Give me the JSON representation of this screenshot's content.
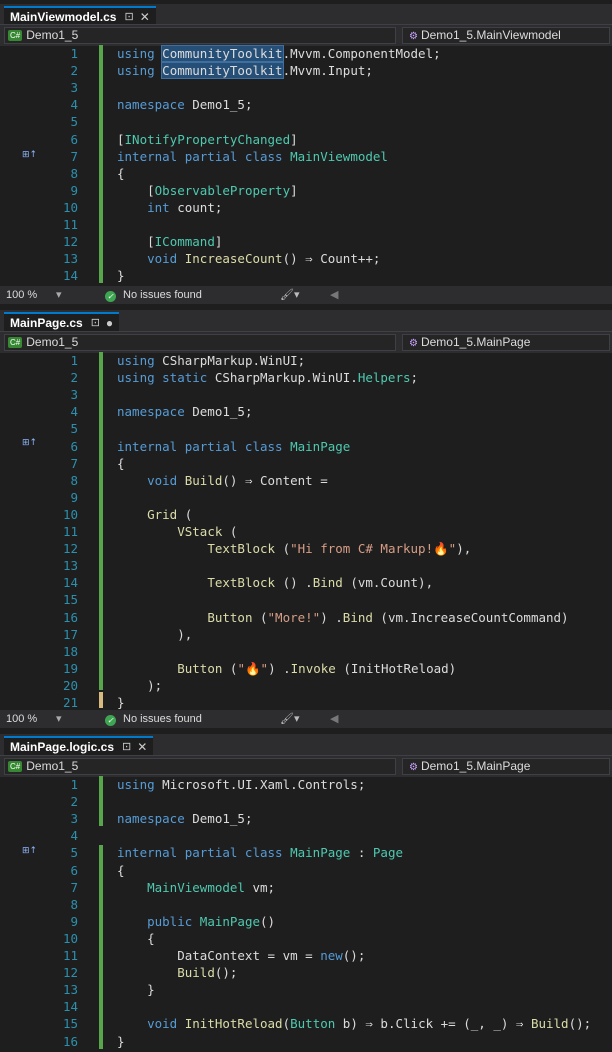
{
  "panes": [
    {
      "tab": "MainViewmodel.cs",
      "tab_state": "⊡",
      "nav_left": "Demo1_5",
      "nav_right": "Demo1_5.MainViewmodel",
      "status_zoom": "100 %",
      "status_issues": "No issues found",
      "lines": [
        {
          "n": "1",
          "html": "<span class=\"kw\">using</span> <span class=\"hl\">CommunityToolkit</span>.Mvvm.ComponentModel;"
        },
        {
          "n": "2",
          "html": "<span class=\"kw\">using</span> <span class=\"hl\">CommunityToolkit</span>.Mvvm.Input;"
        },
        {
          "n": "3",
          "html": ""
        },
        {
          "n": "4",
          "html": "<span class=\"kw\">namespace</span> Demo1_5;"
        },
        {
          "n": "5",
          "html": ""
        },
        {
          "n": "6",
          "html": "[<span class=\"ty\">INotifyPropertyChanged</span>]"
        },
        {
          "n": "7",
          "html": "<span class=\"kw\">internal partial class</span> <span class=\"ty\">MainViewmodel</span>"
        },
        {
          "n": "8",
          "html": "{"
        },
        {
          "n": "9",
          "html": "    [<span class=\"ty\">ObservableProperty</span>]"
        },
        {
          "n": "10",
          "html": "    <span class=\"kw\">int</span> count;"
        },
        {
          "n": "11",
          "html": ""
        },
        {
          "n": "12",
          "html": "    [<span class=\"ty\">ICommand</span>]"
        },
        {
          "n": "13",
          "html": "    <span class=\"kw\">void</span> <span class=\"fn\">IncreaseCount</span>() ⇒ Count++;"
        },
        {
          "n": "14",
          "html": "}"
        }
      ]
    },
    {
      "tab": "MainPage.cs",
      "tab_state": "●",
      "nav_left": "Demo1_5",
      "nav_right": "Demo1_5.MainPage",
      "status_zoom": "100 %",
      "status_issues": "No issues found",
      "lines": [
        {
          "n": "1",
          "html": "<span class=\"kw\">using</span> CSharpMarkup.WinUI;"
        },
        {
          "n": "2",
          "html": "<span class=\"kw\">using static</span> CSharpMarkup.WinUI.<span class=\"ty\">Helpers</span>;"
        },
        {
          "n": "3",
          "html": ""
        },
        {
          "n": "4",
          "html": "<span class=\"kw\">namespace</span> Demo1_5;"
        },
        {
          "n": "5",
          "html": ""
        },
        {
          "n": "6",
          "html": "<span class=\"kw\">internal partial class</span> <span class=\"ty\">MainPage</span>"
        },
        {
          "n": "7",
          "html": "{"
        },
        {
          "n": "8",
          "html": "    <span class=\"kw\">void</span> <span class=\"fn\">Build</span>() ⇒ Content ="
        },
        {
          "n": "9",
          "html": ""
        },
        {
          "n": "10",
          "html": "    <span class=\"fn\">Grid</span> ("
        },
        {
          "n": "11",
          "html": "        <span class=\"fn\">VStack</span> ("
        },
        {
          "n": "12",
          "html": "            <span class=\"fn\">TextBlock</span> (<span class=\"st\">\"Hi from C# Markup!🔥\"</span>),"
        },
        {
          "n": "13",
          "html": ""
        },
        {
          "n": "14",
          "html": "            <span class=\"fn\">TextBlock</span> () .<span class=\"fn\">Bind</span> (vm.Count),"
        },
        {
          "n": "15",
          "html": ""
        },
        {
          "n": "16",
          "html": "            <span class=\"fn\">Button</span> (<span class=\"st\">\"More!\"</span>) .<span class=\"fn\">Bind</span> (vm.IncreaseCountCommand)"
        },
        {
          "n": "17",
          "html": "        ),"
        },
        {
          "n": "18",
          "html": ""
        },
        {
          "n": "19",
          "html": "        <span class=\"fn\">Button</span> (<span class=\"st\">\"🔥\"</span>) .<span class=\"fn\">Invoke</span> (InitHotReload)"
        },
        {
          "n": "20",
          "html": "    );"
        },
        {
          "n": "21",
          "html": "}"
        }
      ]
    },
    {
      "tab": "MainPage.logic.cs",
      "tab_state": "⊡",
      "nav_left": "Demo1_5",
      "nav_right": "Demo1_5.MainPage",
      "lines": [
        {
          "n": "1",
          "html": "<span class=\"kw\">using</span> Microsoft.UI.Xaml.Controls;"
        },
        {
          "n": "2",
          "html": ""
        },
        {
          "n": "3",
          "html": "<span class=\"kw\">namespace</span> Demo1_5;"
        },
        {
          "n": "4",
          "html": ""
        },
        {
          "n": "5",
          "html": "<span class=\"kw\">internal partial class</span> <span class=\"ty\">MainPage</span> : <span class=\"ty\">Page</span>"
        },
        {
          "n": "6",
          "html": "{"
        },
        {
          "n": "7",
          "html": "    <span class=\"ty\">MainViewmodel</span> vm;"
        },
        {
          "n": "8",
          "html": ""
        },
        {
          "n": "9",
          "html": "    <span class=\"kw\">public</span> <span class=\"ty\">MainPage</span>()"
        },
        {
          "n": "10",
          "html": "    {"
        },
        {
          "n": "11",
          "html": "        DataContext = vm = <span class=\"kw\">new</span>();"
        },
        {
          "n": "12",
          "html": "        <span class=\"fn\">Build</span>();"
        },
        {
          "n": "13",
          "html": "    }"
        },
        {
          "n": "14",
          "html": ""
        },
        {
          "n": "15",
          "html": "    <span class=\"kw\">void</span> <span class=\"fn\">InitHotReload</span>(<span class=\"ty\">Button</span> b) ⇒ b.Click += (_, _) ⇒ <span class=\"fn\">Build</span>();"
        },
        {
          "n": "16",
          "html": "}"
        }
      ]
    }
  ]
}
